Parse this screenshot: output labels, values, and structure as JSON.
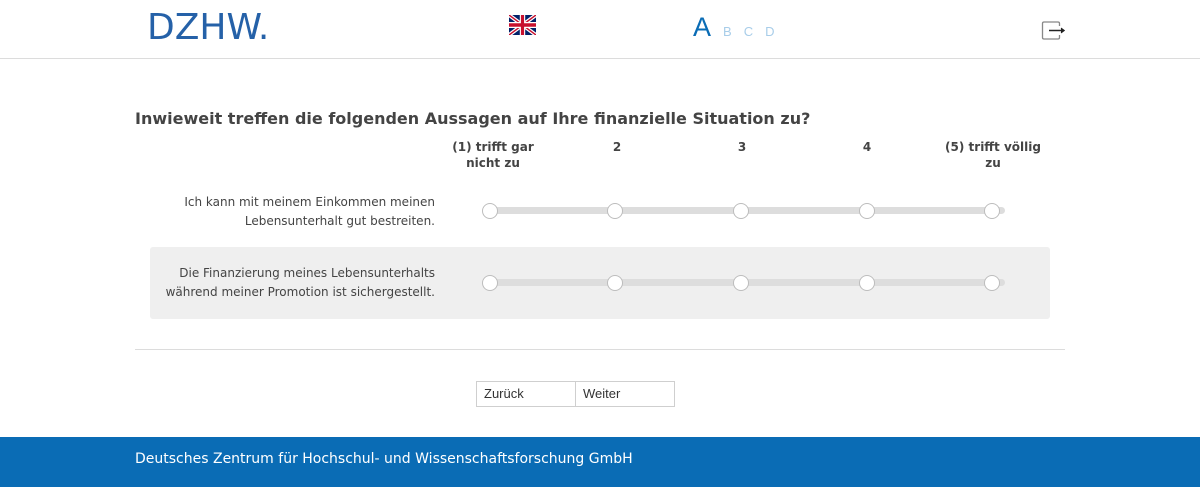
{
  "header": {
    "logo_text": "DZHW.",
    "language_flag_icon": "uk-flag-icon",
    "font_size_options": [
      "A",
      "B",
      "C",
      "D"
    ],
    "font_size_selected": "A",
    "logout_icon": "logout-icon",
    "accent_color": "#0a6cb5"
  },
  "question": {
    "title": "Inwieweit treffen die folgenden Aussagen auf Ihre finanzielle Situation zu?",
    "scale_labels": [
      "(1) trifft gar nicht zu",
      "2",
      "3",
      "4",
      "(5) trifft völlig zu"
    ],
    "items": [
      {
        "label": "Ich kann mit meinem Einkommen meinen Lebensunterhalt gut bestreiten."
      },
      {
        "label": "Die Finanzierung meines Lebensunterhalts während meiner Promotion ist sichergestellt."
      }
    ]
  },
  "navigation": {
    "back_label": "Zurück",
    "next_label": "Weiter"
  },
  "footer": {
    "text": "Deutsches Zentrum für Hochschul- und Wissenschaftsforschung GmbH",
    "color": "#0a6cb5"
  }
}
